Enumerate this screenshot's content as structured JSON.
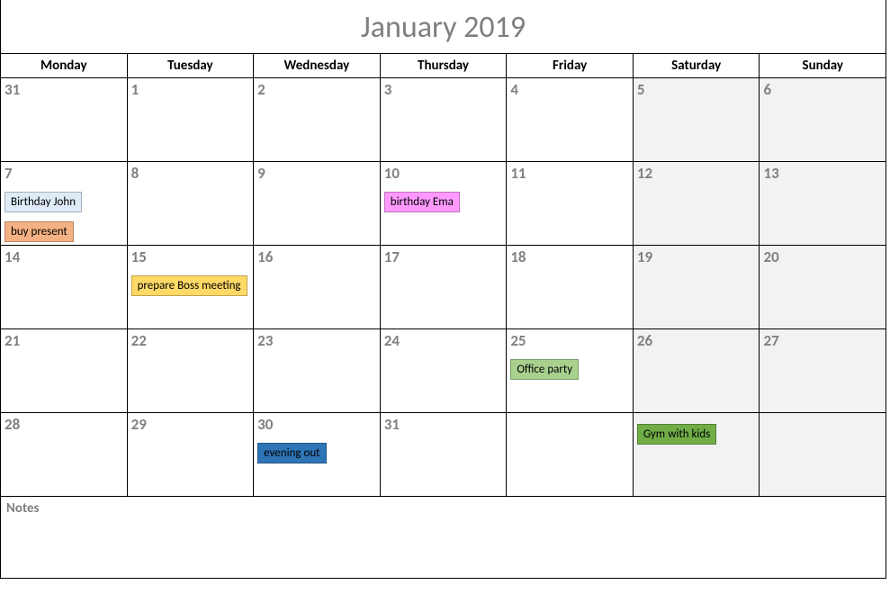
{
  "title": "January 2019",
  "notes_label": "Notes",
  "day_headers": [
    "Monday",
    "Tuesday",
    "Wednesday",
    "Thursday",
    "Friday",
    "Saturday",
    "Sunday"
  ],
  "weeks": [
    {
      "days": [
        {
          "num": "31",
          "weekend": false,
          "events": []
        },
        {
          "num": "1",
          "weekend": false,
          "events": []
        },
        {
          "num": "2",
          "weekend": false,
          "events": []
        },
        {
          "num": "3",
          "weekend": false,
          "events": []
        },
        {
          "num": "4",
          "weekend": false,
          "events": []
        },
        {
          "num": "5",
          "weekend": true,
          "events": []
        },
        {
          "num": "6",
          "weekend": true,
          "events": []
        }
      ]
    },
    {
      "days": [
        {
          "num": "7",
          "weekend": false,
          "events": [
            {
              "label": "Birthday John",
              "color": "lightblue"
            },
            {
              "label": "buy present",
              "color": "orange"
            }
          ]
        },
        {
          "num": "8",
          "weekend": false,
          "events": []
        },
        {
          "num": "9",
          "weekend": false,
          "events": []
        },
        {
          "num": "10",
          "weekend": false,
          "events": [
            {
              "label": "birthday Ema",
              "color": "pink"
            }
          ]
        },
        {
          "num": "11",
          "weekend": false,
          "events": []
        },
        {
          "num": "12",
          "weekend": true,
          "events": []
        },
        {
          "num": "13",
          "weekend": true,
          "events": []
        }
      ]
    },
    {
      "days": [
        {
          "num": "14",
          "weekend": false,
          "events": []
        },
        {
          "num": "15",
          "weekend": false,
          "events": [
            {
              "label": "prepare Boss meeting",
              "color": "yellow"
            }
          ]
        },
        {
          "num": "16",
          "weekend": false,
          "events": []
        },
        {
          "num": "17",
          "weekend": false,
          "events": []
        },
        {
          "num": "18",
          "weekend": false,
          "events": []
        },
        {
          "num": "19",
          "weekend": true,
          "events": []
        },
        {
          "num": "20",
          "weekend": true,
          "events": []
        }
      ]
    },
    {
      "days": [
        {
          "num": "21",
          "weekend": false,
          "events": []
        },
        {
          "num": "22",
          "weekend": false,
          "events": []
        },
        {
          "num": "23",
          "weekend": false,
          "events": []
        },
        {
          "num": "24",
          "weekend": false,
          "events": []
        },
        {
          "num": "25",
          "weekend": false,
          "events": [
            {
              "label": "Office party",
              "color": "lightgreen"
            }
          ]
        },
        {
          "num": "26",
          "weekend": true,
          "events": []
        },
        {
          "num": "27",
          "weekend": true,
          "events": []
        }
      ]
    },
    {
      "days": [
        {
          "num": "28",
          "weekend": false,
          "events": []
        },
        {
          "num": "29",
          "weekend": false,
          "events": []
        },
        {
          "num": "30",
          "weekend": false,
          "events": [
            {
              "label": "evening out",
              "color": "blue"
            }
          ]
        },
        {
          "num": "31",
          "weekend": false,
          "events": []
        },
        {
          "num": "",
          "weekend": false,
          "events": []
        },
        {
          "num": "",
          "weekend": true,
          "events": [
            {
              "label": "Gym with kids",
              "color": "green"
            }
          ]
        },
        {
          "num": "",
          "weekend": true,
          "events": []
        }
      ]
    }
  ],
  "colors": {
    "lightblue": "#deebf7",
    "orange": "#f4b183",
    "pink": "#ff99ff",
    "yellow": "#ffd966",
    "lightgreen": "#a9d18e",
    "blue": "#2e75b6",
    "green": "#70ad47"
  }
}
